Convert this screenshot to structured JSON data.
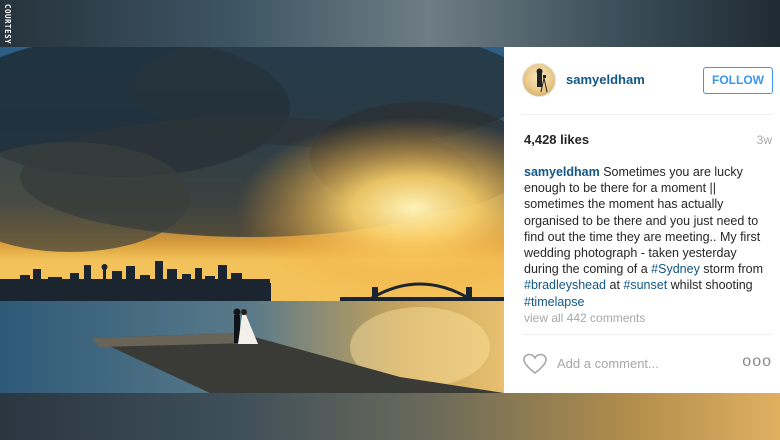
{
  "watermark": "COURTESY INSTAGRAM.COM/SAMYELDHAM",
  "post": {
    "username": "samyeldham",
    "follow_label": "FOLLOW",
    "likes": "4,428 likes",
    "age": "3w",
    "caption": {
      "username": "samyeldham",
      "text_1": "Sometimes you are lucky enough to be there for a moment || sometimes the moment has actually organised to be there and you just need to find out the time they are meeting.. My first wedding photograph - taken yesterday during the coming of a ",
      "tag_1": "#Sydney",
      "text_2": " storm from ",
      "tag_2": "#bradleyshead",
      "text_3": " at ",
      "tag_3": "#sunset",
      "text_4": " whilst shooting ",
      "tag_4": "#timelapse"
    },
    "view_all": "view all 442 comments",
    "comment_placeholder": "Add a comment...",
    "more_glyph": "ooo"
  },
  "icons": {
    "heart": "heart-outline-icon",
    "more": "more-options-icon"
  },
  "colors": {
    "link": "#125688",
    "follow": "#3897f0",
    "muted": "#a5a7aa"
  }
}
